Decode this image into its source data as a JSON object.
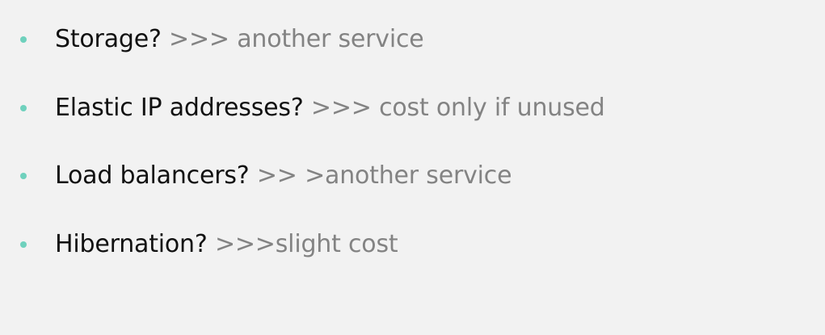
{
  "colors": {
    "background": "#f2f2f2",
    "bullet": "#6fd1bd",
    "question_text": "#111111",
    "answer_text": "#838383"
  },
  "items": [
    {
      "question": "Storage?",
      "answer": ">>> another service"
    },
    {
      "question": "Elastic IP addresses?",
      "answer": ">>> cost only if unused"
    },
    {
      "question": "Load balancers?",
      "answer": ">> >another service"
    },
    {
      "question": "Hibernation?",
      "answer": ">>>slight cost"
    }
  ]
}
